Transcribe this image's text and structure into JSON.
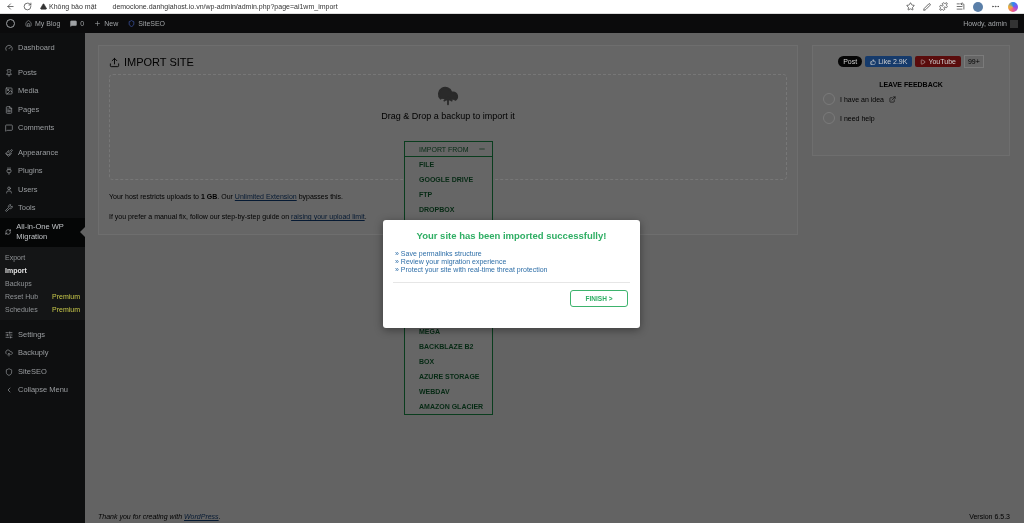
{
  "browser": {
    "security_label": "Không bảo mật",
    "url": "democlone.danhgiahost.io.vn/wp-admin/admin.php?page=ai1wm_import"
  },
  "admin_bar": {
    "site": "My Blog",
    "comments": "0",
    "new": "New",
    "plugin": "SiteSEO",
    "greeting": "Howdy, admin"
  },
  "sidebar": {
    "items": [
      {
        "label": "Dashboard",
        "selected": false
      },
      {
        "label": "Posts",
        "selected": false
      },
      {
        "label": "Media",
        "selected": false
      },
      {
        "label": "Pages",
        "selected": false
      },
      {
        "label": "Comments",
        "selected": false
      },
      {
        "label": "Appearance",
        "selected": false
      },
      {
        "label": "Plugins",
        "selected": false
      },
      {
        "label": "Users",
        "selected": false
      },
      {
        "label": "Tools",
        "selected": false
      },
      {
        "label": "All-in-One WP Migration",
        "selected": true,
        "children": [
          {
            "label": "Export",
            "selected": false
          },
          {
            "label": "Import",
            "selected": true
          },
          {
            "label": "Backups",
            "selected": false
          },
          {
            "label": "Reset Hub",
            "selected": false,
            "badge": "Premium"
          },
          {
            "label": "Schedules",
            "selected": false,
            "badge": "Premium"
          }
        ]
      },
      {
        "label": "Settings",
        "selected": false
      },
      {
        "label": "Backuply",
        "selected": false
      },
      {
        "label": "SiteSEO",
        "selected": false
      },
      {
        "label": "Collapse Menu",
        "selected": false
      }
    ]
  },
  "import": {
    "title": "IMPORT SITE",
    "drop_text": "Drag & Drop a backup to import it",
    "menu": {
      "label": "IMPORT FROM",
      "expanded": true,
      "sources_above": [
        "FILE",
        "GOOGLE DRIVE",
        "FTP",
        "DROPBOX"
      ],
      "sources_below": [
        "MEGA",
        "BACKBLAZE B2",
        "BOX",
        "AZURE STORAGE",
        "WEBDAV",
        "AMAZON GLACIER"
      ]
    },
    "notes": [
      [
        {
          "kind": "text",
          "text": "Your host restricts uploads to "
        },
        {
          "kind": "bold",
          "text": "1 GB"
        },
        {
          "kind": "text",
          "text": ". Our "
        },
        {
          "kind": "link",
          "text": "Unlimited Extension"
        },
        {
          "kind": "text",
          "text": " bypasses this."
        }
      ],
      [
        {
          "kind": "text",
          "text": "If you prefer a manual fix, follow our step-by-step guide on "
        },
        {
          "kind": "link",
          "text": "raising your upload limit"
        },
        {
          "kind": "text",
          "text": "."
        }
      ]
    ]
  },
  "feedback": {
    "social": [
      {
        "kind": "x",
        "label": "Post"
      },
      {
        "kind": "facebook",
        "label": "Like 2.9K"
      },
      {
        "kind": "youtube",
        "label": "YouTube",
        "count": "99+"
      }
    ],
    "heading": "LEAVE FEEDBACK",
    "options": [
      {
        "label": "I have an idea",
        "external": true
      },
      {
        "label": "I need help",
        "external": false
      }
    ]
  },
  "modal": {
    "title": "Your site has been imported successfully!",
    "links": [
      "» Save permalinks structure",
      "» Review your migration experience",
      "» Protect your site with real-time threat protection"
    ],
    "button": "FINISH >"
  },
  "footer": {
    "text": [
      {
        "kind": "text",
        "text": "Thank you for creating with "
      },
      {
        "kind": "link",
        "text": "WordPress"
      },
      {
        "kind": "text",
        "text": "."
      }
    ],
    "version": "Version 6.5.3"
  }
}
